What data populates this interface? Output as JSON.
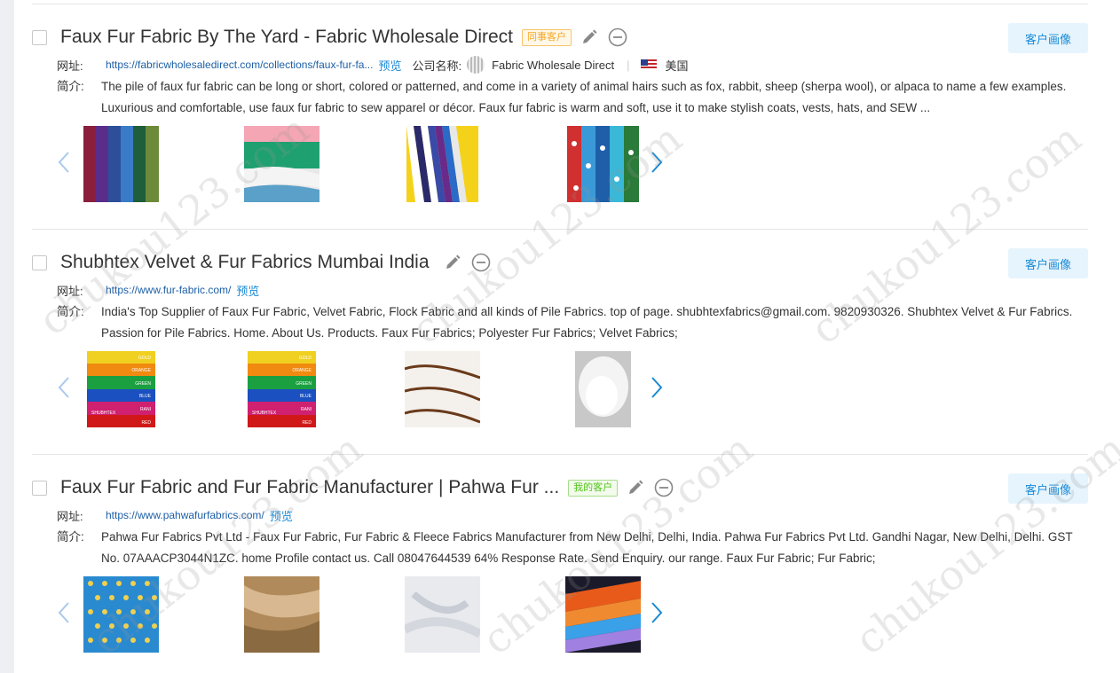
{
  "results": [
    {
      "title": "Faux Fur Fabric By The Yard - Fabric Wholesale Direct",
      "tag": "同事客户",
      "tag_color": "orange",
      "profile_button": "客户画像",
      "url_label": "网址:",
      "url": "https://fabricwholesaledirect.com/collections/faux-fur-fa...",
      "preview": "预览",
      "company_label": "公司名称:",
      "company_name": "Fabric Wholesale Direct",
      "separator": "|",
      "country": "美国",
      "desc_label": "简介:",
      "description": "The pile of faux fur fabric can be long or short, colored or patterned, and come in a variety of animal hairs such as fox, rabbit, sheep (sherpa wool), or alpaca to name a few examples. Luxurious and comfortable, use faux fur fabric to sew apparel or décor. Faux fur fabric is warm and soft, use it to make stylish coats, vests, hats, and SEW ..."
    },
    {
      "title": "Shubhtex Velvet & Fur Fabrics Mumbai India",
      "profile_button": "客户画像",
      "url_label": "网址:",
      "url": "https://www.fur-fabric.com/",
      "preview": "预览",
      "desc_label": "简介:",
      "description": "India's Top Supplier of Faux Fur Fabric, Velvet Fabric, Flock Fabric and all kinds of Pile Fabrics. top of page. shubhtexfabrics@gmail.com. 9820930326. Shubhtex Velvet & Fur Fabrics. Passion for Pile Fabrics. Home. About Us. Products. Faux Fur Fabrics; Polyester Fur Fabrics; Velvet Fabrics;",
      "swatch_labels": [
        "GOLD",
        "ORANGE",
        "GREEN",
        "BLUE",
        "RANI",
        "RED"
      ],
      "brand_label": "SHUBHTEX"
    },
    {
      "title": "Faux Fur Fabric and Fur Fabric Manufacturer | Pahwa Fur ...",
      "tag": "我的客户",
      "tag_color": "green",
      "profile_button": "客户画像",
      "url_label": "网址:",
      "url": "https://www.pahwafurfabrics.com/",
      "preview": "预览",
      "desc_label": "简介:",
      "description": "Pahwa Fur Fabrics Pvt Ltd - Faux Fur Fabric, Fur Fabric & Fleece Fabrics Manufacturer from New Delhi, Delhi, India. Pahwa Fur Fabrics Pvt Ltd. Gandhi Nagar, New Delhi, Delhi. GST No. 07AAACP3044N1ZC. home Profile contact us. Call 08047644539 64% Response Rate. Send Enquiry. our range. Faux Fur Fabric; Fur Fabric;"
    }
  ],
  "watermark": "chukou123.com",
  "colors": {
    "accent": "#1a8ad6",
    "profile_bg": "#e6f4fd",
    "link": "#1d5fa6",
    "tag_orange": "#f5a623",
    "tag_green": "#52c41a"
  }
}
